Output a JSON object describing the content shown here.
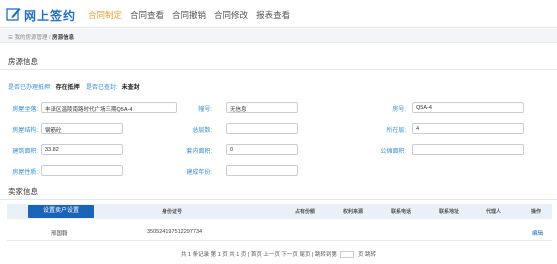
{
  "app": {
    "title": "网上签约"
  },
  "nav": [
    {
      "label": "合同制定",
      "active": true
    },
    {
      "label": "合同查看",
      "active": false
    },
    {
      "label": "合同撤销",
      "active": false
    },
    {
      "label": "合同修改",
      "active": false
    },
    {
      "label": "报表查看",
      "active": false
    }
  ],
  "breadcrumb": {
    "parent": "我的房源管理",
    "sep": "/",
    "current": "房源信息"
  },
  "house_section": {
    "title": "房源信息"
  },
  "status": {
    "freeze_label": "是否已办理抵押:",
    "freeze_value": "存在抵押",
    "sealed_label": "是否已查封:",
    "sealed_value": "未查封"
  },
  "fields": {
    "project_label": "房屋坐落:",
    "project_value": "丰泽区温陵南路时代广场三期Q5A-4",
    "building_label": "幢号:",
    "building_value": "无信息",
    "room_label": "房号:",
    "room_value": "Q5A-4",
    "structure_label": "房屋结构:",
    "structure_value": "钢筋砼",
    "floors_label": "总层数:",
    "floors_value": "",
    "floor_label": "所在层:",
    "floor_value": "4",
    "area_label": "建筑面积:",
    "area_value": "33.82",
    "inner_area_label": "套内面积:",
    "inner_area_value": "0",
    "shared_area_label": "公摊面积:",
    "shared_area_value": "",
    "usage_label": "房屋性质:",
    "usage_value": "",
    "year_label": "建成年份:",
    "year_value": ""
  },
  "seller_section": {
    "title": "卖家信息"
  },
  "table": {
    "set_button": "设置卖户设置",
    "headers": [
      "身份证号",
      "占有份额",
      "权利来源",
      "联系电话",
      "联系地址",
      "代理人",
      "操作"
    ],
    "rows": [
      {
        "name": "邢国毅",
        "id": "350524197512297734",
        "action": "编辑"
      }
    ]
  },
  "pager": {
    "text": "共 1 条记录 第 1 页 共 1 页 | 首页  上一页  下一页  尾页  | 跳转到第",
    "suffix": "页 跳转"
  }
}
